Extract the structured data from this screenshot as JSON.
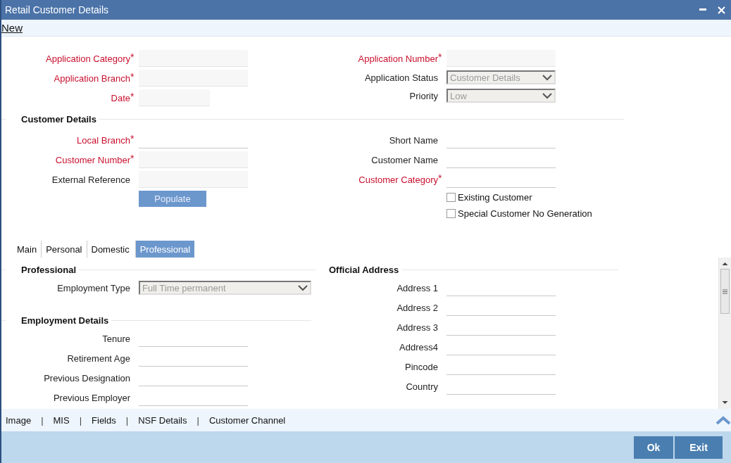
{
  "window": {
    "title": "Retail Customer Details"
  },
  "toolbar": [
    {
      "label": "New"
    }
  ],
  "header": {
    "left": [
      {
        "label": "Application Category",
        "required_mark": "*",
        "kind": "box"
      },
      {
        "label": "Application Branch",
        "required_mark": "*",
        "kind": "box"
      },
      {
        "label": "Date",
        "required_mark": "*",
        "kind": "box-short"
      }
    ],
    "right": [
      {
        "label": "Application Number",
        "required_mark": "*",
        "kind": "box"
      },
      {
        "label": "Application Status",
        "kind": "select",
        "value": "Customer Details",
        "disabled": true
      },
      {
        "label": "Priority",
        "kind": "select",
        "value": "Low",
        "disabled": true
      }
    ]
  },
  "customer_details": {
    "title": "Customer Details",
    "left": [
      {
        "label": "Local Branch",
        "required_mark": "*",
        "kind": "line"
      },
      {
        "label": "Customer Number",
        "required_mark": "*",
        "kind": "box"
      },
      {
        "label": "External Reference",
        "kind": "box"
      }
    ],
    "populate_button": "Populate",
    "right": [
      {
        "label": "Short Name",
        "kind": "line"
      },
      {
        "label": "Customer Name",
        "kind": "line"
      },
      {
        "label": "Customer Category",
        "required_mark": "*",
        "kind": "line"
      }
    ],
    "checkboxes": [
      {
        "label": "Existing Customer",
        "checked": false
      },
      {
        "label": "Special Customer No Generation",
        "checked": false
      }
    ]
  },
  "tabs": [
    {
      "label": "Main",
      "selected": false
    },
    {
      "label": "Personal",
      "selected": false
    },
    {
      "label": "Domestic",
      "selected": false
    },
    {
      "label": "Professional",
      "selected": true
    }
  ],
  "professional": {
    "title": "Professional",
    "fields": [
      {
        "label": "Employment Type",
        "kind": "select",
        "value": "Full Time permanent",
        "disabled": true
      }
    ]
  },
  "employment_details": {
    "title": "Employment Details",
    "fields": [
      {
        "label": "Tenure",
        "kind": "line"
      },
      {
        "label": "Retirement Age",
        "kind": "line"
      },
      {
        "label": "Previous Designation",
        "kind": "line"
      },
      {
        "label": "Previous Employer",
        "kind": "line"
      }
    ]
  },
  "official_address": {
    "title": "Official Address",
    "fields": [
      {
        "label": "Address 1",
        "kind": "line"
      },
      {
        "label": "Address 2",
        "kind": "line"
      },
      {
        "label": "Address 3",
        "kind": "line"
      },
      {
        "label": "Address4",
        "kind": "line"
      },
      {
        "label": "Pincode",
        "kind": "line"
      },
      {
        "label": "Country",
        "kind": "line"
      }
    ]
  },
  "bottom_links": [
    {
      "kind": "link",
      "label": "Image"
    },
    {
      "kind": "separator",
      "label": "|"
    },
    {
      "kind": "link",
      "label": "MIS"
    },
    {
      "kind": "separator",
      "label": "|"
    },
    {
      "kind": "link",
      "label": "Fields"
    },
    {
      "kind": "separator",
      "label": "|"
    },
    {
      "kind": "link",
      "label": "NSF Details"
    },
    {
      "kind": "separator",
      "label": "|"
    },
    {
      "kind": "link",
      "label": "Customer Channel"
    }
  ],
  "buttons": [
    "Ok",
    "Exit"
  ]
}
